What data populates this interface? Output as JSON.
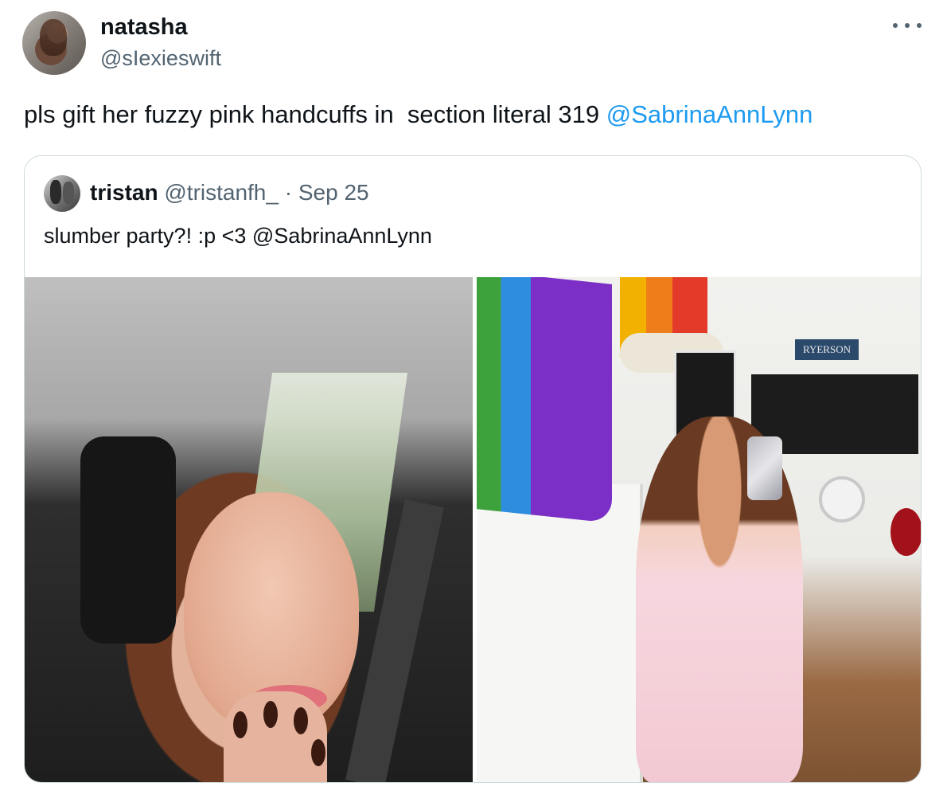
{
  "author": {
    "display_name": "natasha",
    "handle": "@sIexieswift",
    "avatar": "profile-photo"
  },
  "more_icon": "ellipsis-icon",
  "tweet": {
    "text": "pls gift her fuzzy pink handcuffs in  section literal 319 ",
    "mention": "@SabrinaAnnLynn"
  },
  "quoted_tweet": {
    "display_name": "tristan",
    "handle": "@tristanfh_",
    "separator": "·",
    "date": "Sep 25",
    "text": "slumber party?! :p <3 @SabrinaAnnLynn",
    "media": [
      {
        "kind": "photo",
        "description_icon": "car-selfie-photo"
      },
      {
        "kind": "photo",
        "description_icon": "mirror-selfie-photo",
        "sign_text": "RYERSON"
      }
    ]
  },
  "colors": {
    "text_primary": "#0f1419",
    "text_secondary": "#536471",
    "link": "#1d9bf0",
    "border": "#cfd9de"
  }
}
